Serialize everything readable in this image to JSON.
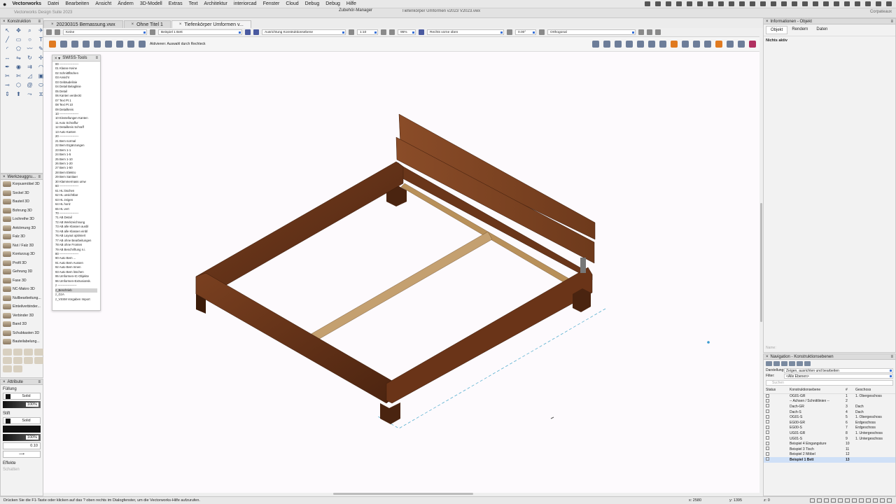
{
  "menubar": {
    "app": "Vectorworks",
    "items": [
      "Datei",
      "Bearbeiten",
      "Ansicht",
      "Ändern",
      "3D-Modell",
      "Extras",
      "Text",
      "Architektur",
      "interiorcad",
      "Fenster",
      "Cloud",
      "Debug",
      "Debug",
      "Hilfe"
    ]
  },
  "titlebar": {
    "suite": "Vectorworks Design Suite 2023",
    "zubehoer": "Zubehör-Manager",
    "document": "Tiefenkörper Umformen v2023 V2023.vwx",
    "corporate": "Corpateaux"
  },
  "tabs": [
    {
      "label": "20230315 Bemassung.vwx",
      "close": "×"
    },
    {
      "label": "Ohne Titel 1",
      "close": "×"
    },
    {
      "label": "Tiefenkörper Umformen v...",
      "close": "×"
    }
  ],
  "toolbar1": {
    "class": "Keine",
    "layer": "Beispiel 1 Bett",
    "alignment": "Ausrichtung Konstruktionsebene",
    "scale": "1:10",
    "zoom": "95%",
    "view": "Rechts vorne oben",
    "angle": "0.00°",
    "projection": "Orthogonal"
  },
  "toolbar2": {
    "hint": "Aktivieren: Auswahl durch Rechteck"
  },
  "panels": {
    "konstruktion": "Konstruktion",
    "werkzeug": "Werkzeuggru...",
    "attribute": "Attribute",
    "info": "Informationen - Objekt",
    "navigation": "Navigation - Konstruktionsebenen",
    "swiss": "SWISS-Tools"
  },
  "konstruktion_icons": [
    "selection-icon",
    "pan-icon",
    "zoom-icon",
    "flyover-icon",
    "line-icon",
    "rectangle-icon",
    "circle-icon",
    "text-icon",
    "arc-icon",
    "polygon-icon",
    "polyline-icon",
    "freehand-icon",
    "dimension-icon",
    "mirror-icon",
    "rotate-icon",
    "move-icon",
    "eyedropper-icon",
    "attribute-icon",
    "offset-icon",
    "fillet-icon",
    "split-icon",
    "trim-icon",
    "chamfer-icon",
    "clip-icon",
    "connect-icon",
    "reshape-icon",
    "spiral-icon",
    "ellipse-icon",
    "push-pull-icon",
    "extrude-icon",
    "sweep-icon",
    "loft-icon"
  ],
  "werkzeug_items": [
    "Korpusmöbel 3D",
    "Sockel 3D",
    "Bauteil 3D",
    "Bohrung 3D",
    "Lochreihe 3D",
    "Ankörnung 3D",
    "Falz 3D",
    "Nut / Falz 3D",
    "Konturzug 3D",
    "Profil 3D",
    "Gehrung 3D",
    "Fase 3D",
    "NC-Makro 3D",
    "Nullbearbeitung...",
    "Einteilverbinder...",
    "Verbinder 3D",
    "Band 3D",
    "Schubkasten 3D",
    "Bauteilabelung..."
  ],
  "attribute": {
    "fill_label": "Füllung",
    "fill_type": "Solid",
    "fill_opacity": "100%",
    "pen_label": "Stift",
    "pen_type": "Solid",
    "pen_opacity": "100%",
    "line_weight": "0.10",
    "effects_label": "Effekte",
    "shadow": "Schatten"
  },
  "swiss_items": [
    "00 -------------------",
    "01 Klasse Keine",
    "02 Schnittflächen",
    "03 Ansicht",
    "03 Gebäudelinie",
    "04 Detail Belaglinie",
    "05 Detail",
    "06 Kanten verdeckt",
    "07 Text Pt 1",
    "08 Text Pt 10",
    "09 Detailkreis",
    "10 -------------------",
    "10 Einstellungen Kanten",
    "11 Auto Schraffur",
    "12 Detailkreis Schraff",
    "13 Auto Kanten",
    "20 -------------------",
    "21 Bem normal",
    "22 Bem Ergänzungen",
    "23 Bem 1-1",
    "24 Bem 1-5",
    "25 Bem 1-10",
    "26 Bem 1-20",
    "27 Bem 1-50",
    "28 Bem Elektro",
    "29 Bem Sanitaer",
    "30 Klammermass umw",
    "60 -------------------",
    "61 HL löschen",
    "62 HL unsichtbar",
    "63 HL zeigen",
    "64 HL horiz",
    "65 HL vert",
    "70 -------------------",
    "71 AB Detail",
    "72 AB Werkzeichnung",
    "73 AB alle Klassen ausbl",
    "74 AB alle Klassen einbl",
    "76 AB Layout optimiert",
    "77 AB ohne Bearbeitungen",
    "78 AB ohne Fronten",
    "79 AB Beschriftung n.i.",
    "80 -------------------",
    "90 Auto Bem ...",
    "91 Auto Bem Aussen",
    "92 Auto Bem Innen",
    "93 Auto Bem löschen",
    "95 Umformen-IC-Objekte",
    "96 Umformen-Extrusionsk.",
    "z -------------------",
    "z_Beschrieb",
    "z_GzA",
    "z_VSSM Vorgaben Import"
  ],
  "swiss_selected": 50,
  "info": {
    "tabs": [
      "Objekt",
      "Rendern",
      "Daten"
    ],
    "status": "Nichts aktiv",
    "footer": "Name:"
  },
  "navigation": {
    "display_label": "Darstellung:",
    "display_value": "Zeigen, ausrichten und bearbeiten",
    "filter_label": "Filter:",
    "filter_value": "<Alle Ebenen>",
    "search_placeholder": "Suchen",
    "columns": [
      "Status",
      "Konstruktionsebene",
      "#",
      "Geschoss"
    ],
    "rows": [
      [
        "OG01-GR",
        "1",
        "1. Obergeschoss"
      ],
      [
        "-- Achsen / Schnittlinien --",
        "2",
        ""
      ],
      [
        "Dach-GR",
        "3",
        "Dach"
      ],
      [
        "Dach-S",
        "4",
        "Dach"
      ],
      [
        "OG01-S",
        "5",
        "1. Obergeschoss"
      ],
      [
        "EG00-GR",
        "6",
        "Erdgeschoss"
      ],
      [
        "EG00-S",
        "7",
        "Erdgeschoss"
      ],
      [
        "UG01-GR",
        "8",
        "1. Untergeschoss"
      ],
      [
        "UG01-S",
        "9",
        "1. Untergeschoss"
      ],
      [
        "Beispiel 4 Eingangsture",
        "10",
        ""
      ],
      [
        "Beispiel 3 Tisch",
        "11",
        ""
      ],
      [
        "Beispiel 2 Möbel",
        "12",
        ""
      ],
      [
        "Beispiel 1 Bett",
        "13",
        ""
      ]
    ],
    "selected_row": 12
  },
  "statusbar": {
    "message": "Drücken Sie die F1-Taste oder klicken auf das ? oben rechts im Dialogfenster, um die Vectorworks-Hilfe aufzurufen.",
    "x": "x: 2580",
    "y": "y: 1395",
    "z": "z: 0"
  },
  "colors": {
    "wood_dark": "#5a2d15",
    "wood_mid": "#7a4020",
    "wood_light": "#b8905a",
    "selection_row": "#cfe0f7"
  }
}
